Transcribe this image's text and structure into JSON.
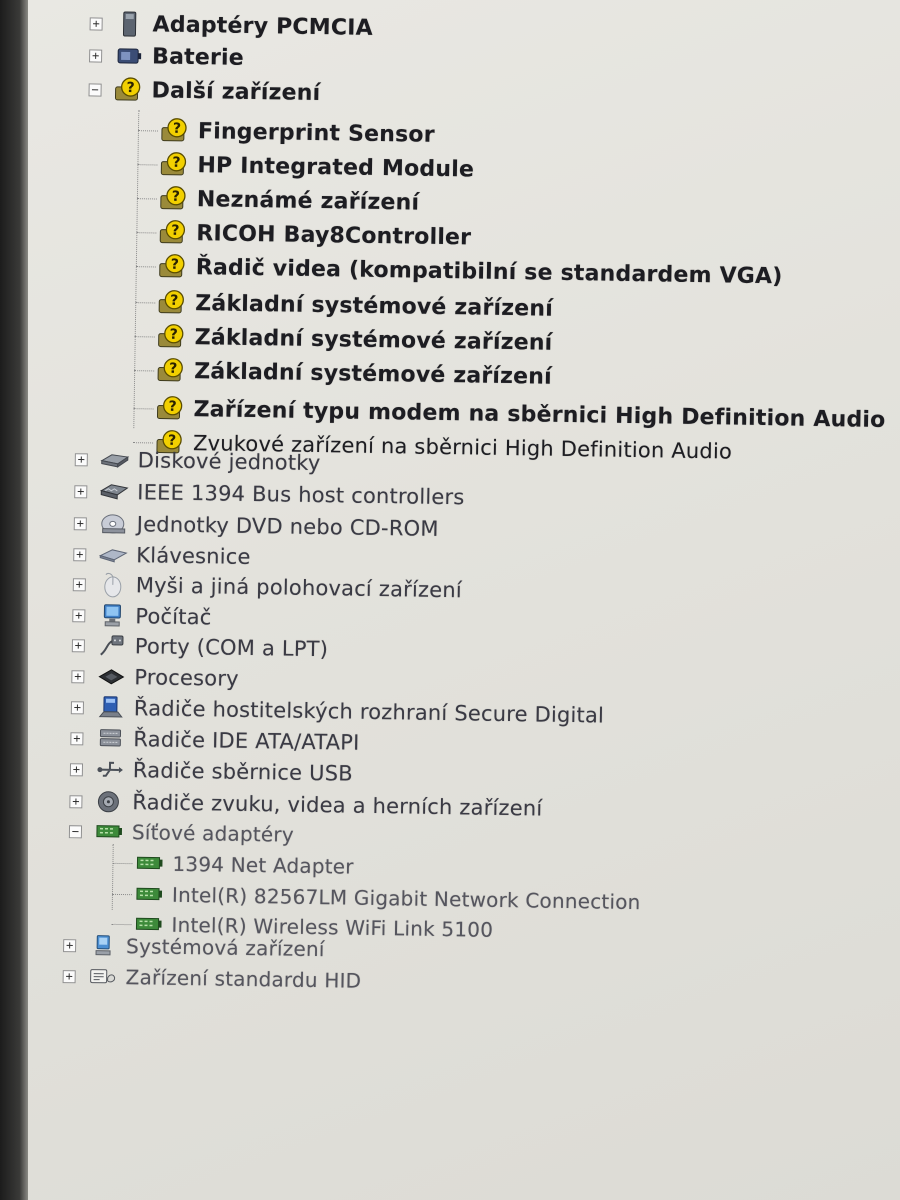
{
  "tree": {
    "nodes": [
      {
        "label": "Adaptéry PCMCIA",
        "icon": "pcmcia-card-icon",
        "expander": "+"
      },
      {
        "label": "Baterie",
        "icon": "battery-icon",
        "expander": "+"
      },
      {
        "label": "Další zařízení",
        "icon": "unknown-device-icon",
        "expander": "−"
      },
      {
        "label": "Fingerprint Sensor",
        "icon": "unknown-device-icon"
      },
      {
        "label": "HP Integrated Module",
        "icon": "unknown-device-icon"
      },
      {
        "label": "Neznámé zařízení",
        "icon": "unknown-device-icon"
      },
      {
        "label": "RICOH Bay8Controller",
        "icon": "unknown-device-icon"
      },
      {
        "label": "Řadič videa (kompatibilní se standardem VGA)",
        "icon": "unknown-device-icon"
      },
      {
        "label": "Základní systémové zařízení",
        "icon": "unknown-device-icon"
      },
      {
        "label": "Základní systémové zařízení",
        "icon": "unknown-device-icon"
      },
      {
        "label": "Základní systémové zařízení",
        "icon": "unknown-device-icon"
      },
      {
        "label": "Zařízení typu modem na sběrnici High Definition Audio",
        "icon": "unknown-device-icon"
      },
      {
        "label": "Zvukové zařízení na sběrnici High Definition Audio",
        "icon": "unknown-device-icon"
      },
      {
        "label": "Diskové jednotky",
        "icon": "disk-drive-icon",
        "expander": "+"
      },
      {
        "label": "IEEE 1394 Bus host controllers",
        "icon": "firewire-controller-icon",
        "expander": "+"
      },
      {
        "label": "Jednotky DVD nebo CD-ROM",
        "icon": "dvd-drive-icon",
        "expander": "+"
      },
      {
        "label": "Klávesnice",
        "icon": "keyboard-icon",
        "expander": "+"
      },
      {
        "label": "Myši a jiná polohovací zařízení",
        "icon": "mouse-icon",
        "expander": "+"
      },
      {
        "label": "Počítač",
        "icon": "computer-icon",
        "expander": "+"
      },
      {
        "label": "Porty (COM a LPT)",
        "icon": "port-icon",
        "expander": "+"
      },
      {
        "label": "Procesory",
        "icon": "processor-icon",
        "expander": "+"
      },
      {
        "label": "Řadiče hostitelských rozhraní Secure Digital",
        "icon": "sd-host-controller-icon",
        "expander": "+"
      },
      {
        "label": "Řadiče IDE ATA/ATAPI",
        "icon": "ide-controller-icon",
        "expander": "+"
      },
      {
        "label": "Řadiče sběrnice USB",
        "icon": "usb-icon",
        "expander": "+"
      },
      {
        "label": "Řadiče zvuku, videa a herních zařízení",
        "icon": "sound-icon",
        "expander": "+"
      },
      {
        "label": "Síťové adaptéry",
        "icon": "network-adapter-icon",
        "expander": "−"
      },
      {
        "label": "1394 Net Adapter",
        "icon": "network-adapter-icon"
      },
      {
        "label": "Intel(R) 82567LM Gigabit Network Connection",
        "icon": "network-adapter-icon"
      },
      {
        "label": "Intel(R) Wireless WiFi Link 5100",
        "icon": "network-adapter-icon"
      },
      {
        "label": "Systémová zařízení",
        "icon": "system-device-icon",
        "expander": "+"
      },
      {
        "label": "Zařízení standardu HID",
        "icon": "hid-device-icon",
        "expander": "+"
      }
    ]
  },
  "colors": {
    "warning_yellow": "#e9c500",
    "network_green": "#3d8a3a",
    "text": "#1d1d22"
  }
}
